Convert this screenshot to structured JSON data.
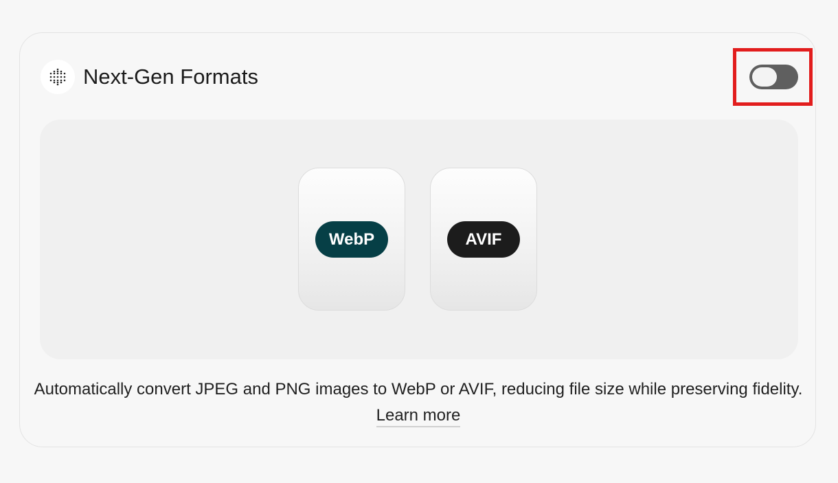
{
  "header": {
    "title": "Next-Gen Formats",
    "icon": "dot-grid-icon",
    "toggle_state": "off"
  },
  "preview": {
    "formats": [
      {
        "label": "WebP",
        "color": "#063f46"
      },
      {
        "label": "AVIF",
        "color": "#1c1c1c"
      }
    ]
  },
  "description": {
    "text": "Automatically convert JPEG and PNG images to WebP or AVIF, reducing file size while preserving fidelity.",
    "link_label": "Learn more"
  },
  "colors": {
    "highlight": "#e21d1d",
    "toggle_track": "#5f5f5f"
  }
}
